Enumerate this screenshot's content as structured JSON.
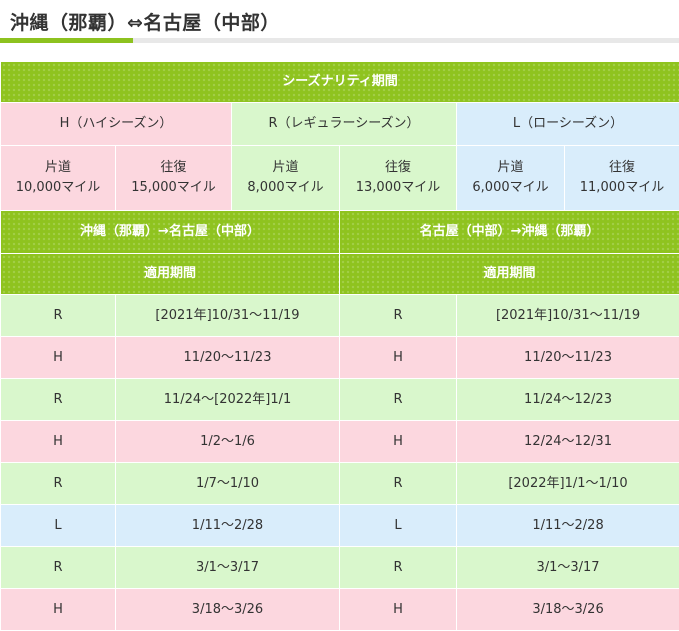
{
  "page": {
    "title": "沖縄（那覇）⇔名古屋（中部）"
  },
  "seasonality": {
    "header": "シーズナリティ期間",
    "seasons": [
      {
        "label": "H（ハイシーズン）",
        "color": "#fcd7df",
        "one_way_label": "片道",
        "one_way_miles": "10,000マイル",
        "round_trip_label": "往復",
        "round_trip_miles": "15,000マイル"
      },
      {
        "label": "R（レギュラーシーズン）",
        "color": "#d9f7cc",
        "one_way_label": "片道",
        "one_way_miles": "8,000マイル",
        "round_trip_label": "往復",
        "round_trip_miles": "13,000マイル"
      },
      {
        "label": "L（ローシーズン）",
        "color": "#d9edfb",
        "one_way_label": "片道",
        "one_way_miles": "6,000マイル",
        "round_trip_label": "往復",
        "round_trip_miles": "11,000マイル"
      }
    ]
  },
  "routes": {
    "outbound_header": "沖縄（那覇）→名古屋（中部）",
    "inbound_header": "名古屋（中部）→沖縄（那覇）",
    "period_header": "適用期間",
    "rows": [
      {
        "out_season": "R",
        "out_period": "[2021年]10/31〜11/19",
        "in_season": "R",
        "in_period": "[2021年]10/31〜11/19"
      },
      {
        "out_season": "H",
        "out_period": "11/20〜11/23",
        "in_season": "H",
        "in_period": "11/20〜11/23"
      },
      {
        "out_season": "R",
        "out_period": "11/24〜[2022年]1/1",
        "in_season": "R",
        "in_period": "11/24〜12/23"
      },
      {
        "out_season": "H",
        "out_period": "1/2〜1/6",
        "in_season": "H",
        "in_period": "12/24〜12/31"
      },
      {
        "out_season": "R",
        "out_period": "1/7〜1/10",
        "in_season": "R",
        "in_period": "[2022年]1/1〜1/10"
      },
      {
        "out_season": "L",
        "out_period": "1/11〜2/28",
        "in_season": "L",
        "in_period": "1/11〜2/28"
      },
      {
        "out_season": "R",
        "out_period": "3/1〜3/17",
        "in_season": "R",
        "in_period": "3/1〜3/17"
      },
      {
        "out_season": "H",
        "out_period": "3/18〜3/26",
        "in_season": "H",
        "in_period": "3/18〜3/26"
      }
    ]
  },
  "colors": {
    "header_green": "#8fc31f",
    "high_pink": "#fcd7df",
    "regular_green": "#d9f7cc",
    "low_blue": "#d9edfb"
  }
}
